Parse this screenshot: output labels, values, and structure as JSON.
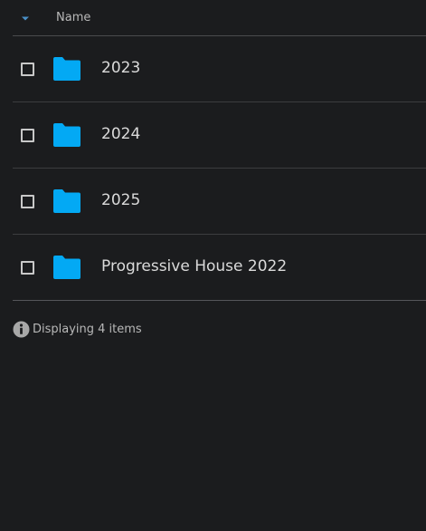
{
  "header": {
    "sort_icon": "caret-down-icon",
    "column_name": "Name"
  },
  "accent_color": "#03a9f4",
  "items": [
    {
      "label": "2023",
      "type": "folder"
    },
    {
      "label": "2024",
      "type": "folder"
    },
    {
      "label": "2025",
      "type": "folder"
    },
    {
      "label": "Progressive House 2022",
      "type": "folder"
    }
  ],
  "status": {
    "icon": "info-icon",
    "text": "Displaying 4 items"
  }
}
